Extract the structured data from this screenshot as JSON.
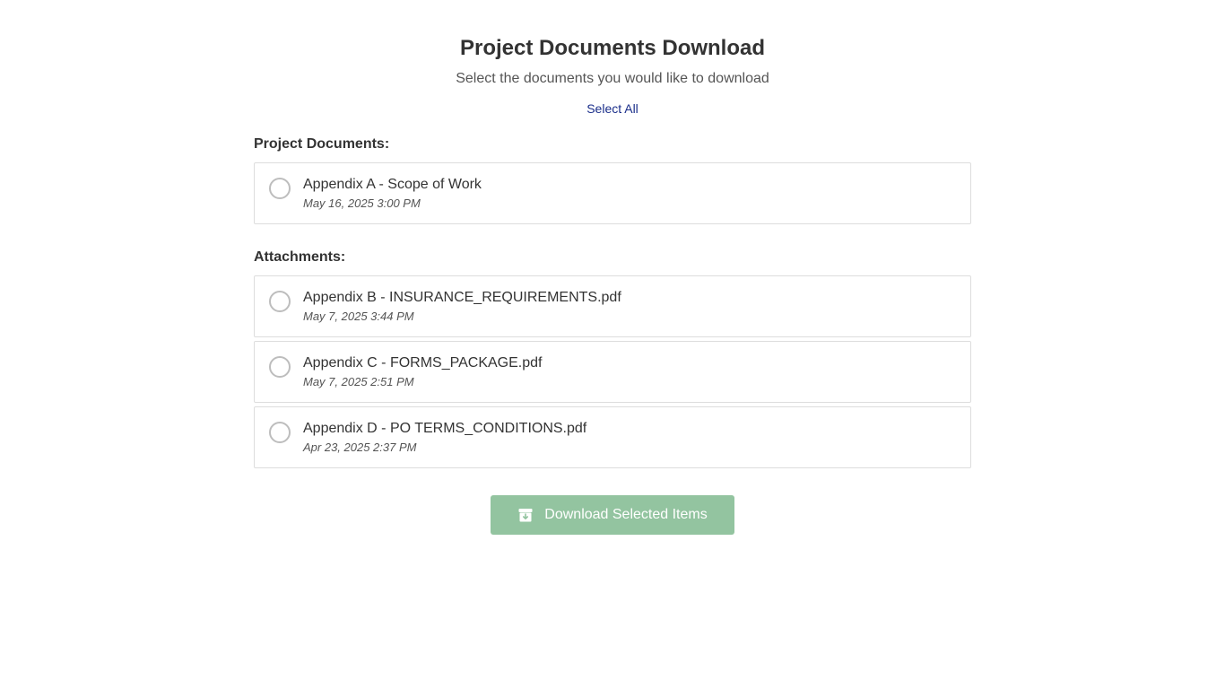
{
  "header": {
    "title": "Project Documents Download",
    "subtitle": "Select the documents you would like to download",
    "select_all_label": "Select All"
  },
  "project_documents": {
    "heading": "Project Documents:",
    "items": [
      {
        "name": "Appendix A - Scope of Work",
        "date": "May 16, 2025 3:00 PM",
        "selected": false
      }
    ]
  },
  "attachments": {
    "heading": "Attachments:",
    "items": [
      {
        "name": "Appendix B - INSURANCE_REQUIREMENTS.pdf",
        "date": "May 7, 2025 3:44 PM",
        "selected": false
      },
      {
        "name": "Appendix C - FORMS_PACKAGE.pdf",
        "date": "May 7, 2025 2:51 PM",
        "selected": false
      },
      {
        "name": "Appendix D - PO TERMS_CONDITIONS.pdf",
        "date": "Apr 23, 2025 2:37 PM",
        "selected": false
      }
    ]
  },
  "download": {
    "label": "Download Selected Items",
    "icon": "archive-download-icon",
    "color": "#93c4a0"
  },
  "colors": {
    "link": "#1a2e8a",
    "border": "#dddddd",
    "radio_border": "#bdbdbd"
  }
}
